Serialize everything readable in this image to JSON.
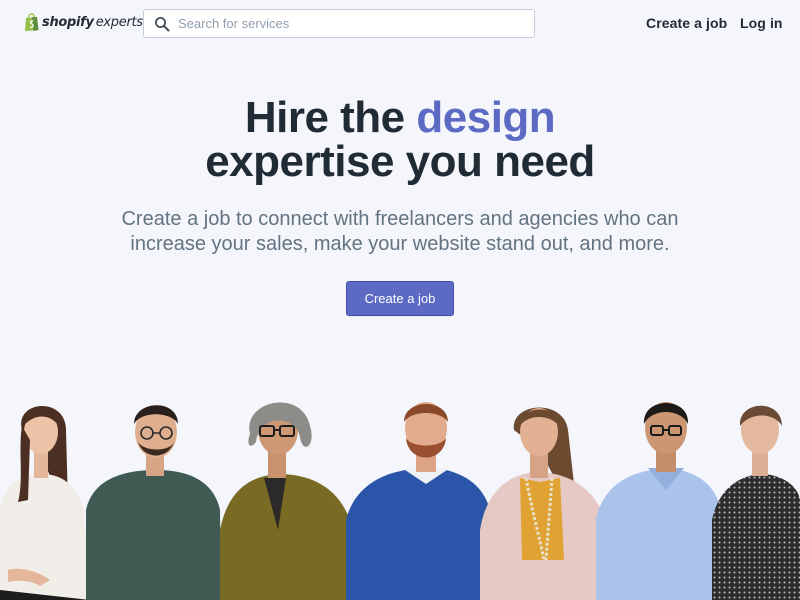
{
  "header": {
    "logo": {
      "brand": "shopify",
      "suffix": "experts"
    },
    "search": {
      "placeholder": "Search for services",
      "value": ""
    },
    "nav": {
      "create_job": "Create a job",
      "login": "Log in"
    }
  },
  "hero": {
    "title_part1": "Hire the ",
    "title_accent": "design",
    "title_part2": "expertise you need",
    "subtitle": "Create a job to connect with freelancers and agencies who can increase your sales, make your website stand out, and more.",
    "cta_label": "Create a job"
  },
  "people": [
    {
      "name": "person-1",
      "shirt": "white blouse",
      "hair": "long brown"
    },
    {
      "name": "person-2",
      "shirt": "green sweater",
      "hair": "short dark"
    },
    {
      "name": "person-3",
      "shirt": "olive blazer",
      "hair": "curly gray"
    },
    {
      "name": "person-4",
      "shirt": "blue sweater",
      "hair": "red short"
    },
    {
      "name": "person-5",
      "shirt": "pink blazer",
      "hair": "wavy brown"
    },
    {
      "name": "person-6",
      "shirt": "light blue shirt",
      "hair": "short dark"
    },
    {
      "name": "person-7",
      "shirt": "patterned top",
      "hair": "short brown"
    }
  ],
  "colors": {
    "background": "#f4f6fb",
    "accent": "#5c6ac4",
    "text": "#212b36",
    "subtext": "#637381",
    "brand_green": "#95bf47"
  },
  "icons": {
    "logo": "shopify-bag-icon",
    "search": "search-icon"
  }
}
